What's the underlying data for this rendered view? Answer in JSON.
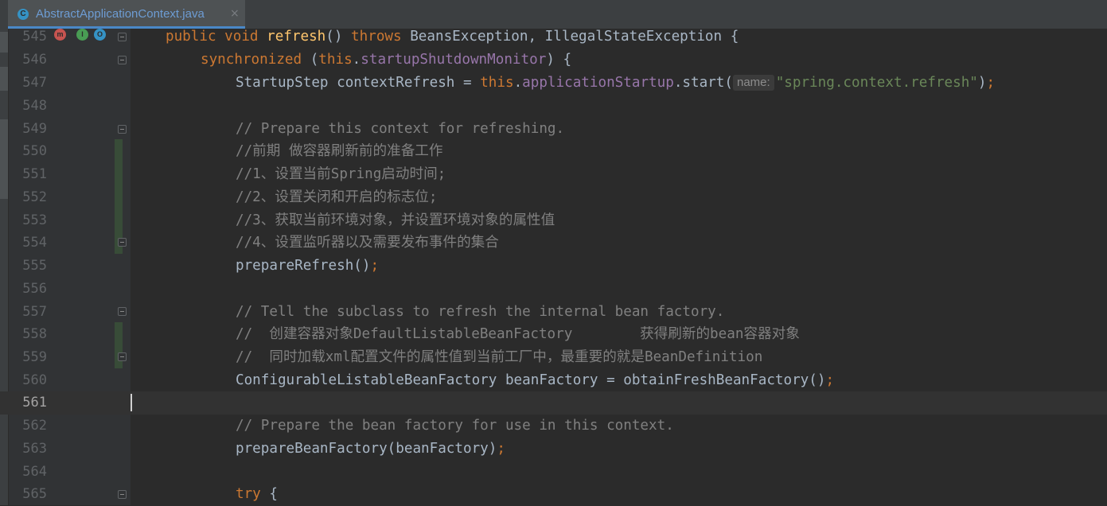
{
  "tab": {
    "icon_letter": "C",
    "title": "AbstractApplicationContext.java",
    "close": "×"
  },
  "gutter_icons": [
    {
      "name": "override-method-icon",
      "glyph": "m",
      "color": "#c75450"
    },
    {
      "name": "implemented-icon",
      "glyph": "I",
      "color": "#499c54"
    },
    {
      "name": "overriding-icon",
      "glyph": "O",
      "color": "#3592c4"
    }
  ],
  "lines": {
    "l545": {
      "num": "545",
      "t1": "public void ",
      "t2": "refresh",
      "t3": "() ",
      "t4": "throws ",
      "t5": "BeansException, IllegalStateException {"
    },
    "l546": {
      "num": "546",
      "t1": "synchronized ",
      "t2": "(",
      "t3": "this",
      "t4": ".",
      "t5": "startupShutdownMonitor",
      "t6": ") {"
    },
    "l547": {
      "num": "547",
      "t1": "StartupStep contextRefresh = ",
      "t2": "this",
      "t3": ".",
      "t4": "applicationStartup",
      "t5": ".start(",
      "hint": "name:",
      "t6": "\"spring.context.refresh\"",
      "t7": ")",
      "t8": ";"
    },
    "l548": {
      "num": "548"
    },
    "l549": {
      "num": "549",
      "text": "// Prepare this context for refreshing."
    },
    "l550": {
      "num": "550",
      "text": "//前期 做容器刷新前的准备工作"
    },
    "l551": {
      "num": "551",
      "text": "//1、设置当前Spring启动时间;"
    },
    "l552": {
      "num": "552",
      "text": "//2、设置关闭和开启的标志位;"
    },
    "l553": {
      "num": "553",
      "text": "//3、获取当前环境对象，并设置环境对象的属性值"
    },
    "l554": {
      "num": "554",
      "text": "//4、设置监听器以及需要发布事件的集合"
    },
    "l555": {
      "num": "555",
      "t1": "prepareRefresh()",
      "t2": ";"
    },
    "l556": {
      "num": "556"
    },
    "l557": {
      "num": "557",
      "text": "// Tell the subclass to refresh the internal bean factory."
    },
    "l558": {
      "num": "558",
      "text": "//  创建容器对象DefaultListableBeanFactory        获得刷新的bean容器对象"
    },
    "l559": {
      "num": "559",
      "text": "//  同时加载xml配置文件的属性值到当前工厂中，最重要的就是BeanDefinition"
    },
    "l560": {
      "num": "560",
      "t1": "ConfigurableListableBeanFactory beanFactory = obtainFreshBeanFactory()",
      "t2": ";"
    },
    "l561": {
      "num": "561"
    },
    "l562": {
      "num": "562",
      "text": "// Prepare the bean factory for use in this context."
    },
    "l563": {
      "num": "563",
      "t1": "prepareBeanFactory(beanFactory)",
      "t2": ";"
    },
    "l564": {
      "num": "564"
    },
    "l565": {
      "num": "565",
      "t1": "try ",
      "t2": "{"
    }
  },
  "colors": {
    "keyword": "#cc7832",
    "method": "#ffc66d",
    "field": "#9876aa",
    "string": "#6a8759",
    "comment": "#808080",
    "text": "#a9b7c6",
    "background": "#2b2b2b"
  }
}
